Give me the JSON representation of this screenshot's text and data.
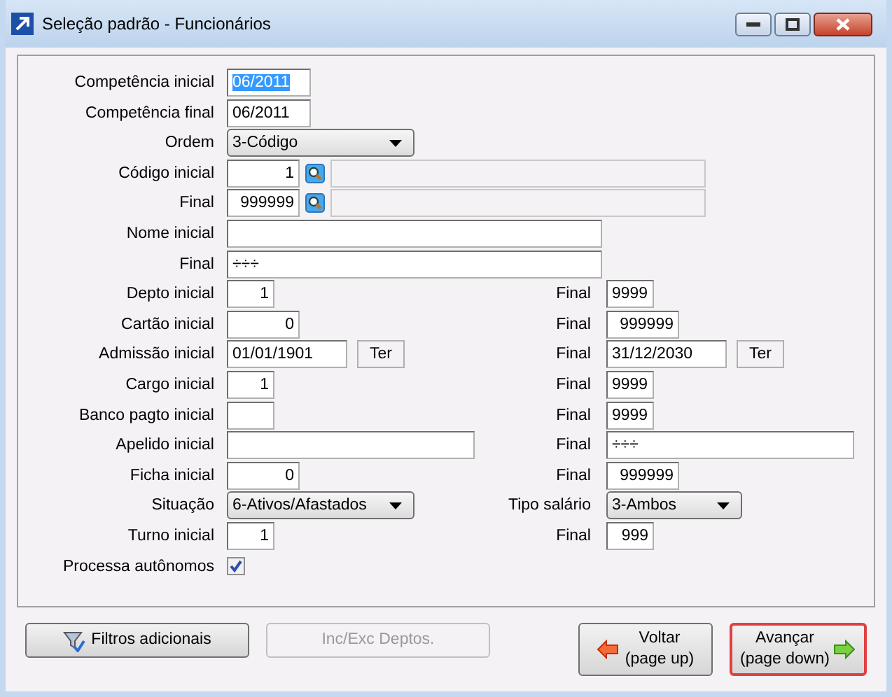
{
  "window": {
    "title": "Seleção padrão - Funcionários"
  },
  "rows": [
    {
      "label": "Competência inicial",
      "field": {
        "kind": "text",
        "value": "06/2011",
        "highlighted": true
      }
    },
    {
      "label": "Competência final",
      "field": {
        "kind": "text",
        "value": "06/2011"
      }
    },
    {
      "label": "Ordem",
      "field": {
        "kind": "select",
        "value": "3-Código"
      }
    },
    {
      "label": "Código inicial",
      "field": {
        "kind": "lookup",
        "value": "1"
      }
    },
    {
      "label": "Final",
      "field": {
        "kind": "lookup",
        "value": "999999"
      }
    },
    {
      "label": "Nome inicial",
      "field": {
        "kind": "text"
      }
    },
    {
      "label": "Final",
      "field": {
        "kind": "text",
        "value": "÷÷÷"
      }
    },
    {
      "label": "Depto inicial",
      "field": {
        "kind": "number",
        "value": "1"
      },
      "right": {
        "label": "Final",
        "field": {
          "kind": "text",
          "value": "9999"
        }
      }
    },
    {
      "label": "Cartão inicial",
      "field": {
        "kind": "number",
        "value": "0"
      },
      "right": {
        "label": "Final",
        "field": {
          "kind": "number",
          "value": "999999"
        }
      }
    },
    {
      "label": "Admissão inicial",
      "field": {
        "kind": "date",
        "value": "01/01/1901",
        "button": "Ter"
      },
      "right": {
        "label": "Final",
        "field": {
          "kind": "date",
          "value": "31/12/2030",
          "button": "Ter"
        }
      }
    },
    {
      "label": "Cargo inicial",
      "field": {
        "kind": "number",
        "value": "1"
      },
      "right": {
        "label": "Final",
        "field": {
          "kind": "text",
          "value": "9999"
        }
      }
    },
    {
      "label": "Banco pagto inicial",
      "field": {
        "kind": "text"
      },
      "right": {
        "label": "Final",
        "field": {
          "kind": "text",
          "value": "9999"
        }
      }
    },
    {
      "label": "Apelido inicial",
      "field": {
        "kind": "text"
      },
      "right": {
        "label": "Final",
        "field": {
          "kind": "text",
          "value": "÷÷÷"
        }
      }
    },
    {
      "label": "Ficha inicial",
      "field": {
        "kind": "number",
        "value": "0"
      },
      "right": {
        "label": "Final",
        "field": {
          "kind": "number",
          "value": "999999"
        }
      }
    },
    {
      "label": "Situação",
      "field": {
        "kind": "select",
        "value": "6-Ativos/Afastados"
      },
      "right": {
        "label": "Tipo salário",
        "field": {
          "kind": "select",
          "value": "3-Ambos"
        }
      }
    },
    {
      "label": "Turno inicial",
      "field": {
        "kind": "number",
        "value": "1"
      },
      "right": {
        "label": "Final",
        "field": {
          "kind": "number",
          "value": "999"
        }
      }
    },
    {
      "label": "Processa autônomos",
      "field": {
        "kind": "checkbox",
        "checked": true
      }
    }
  ],
  "buttons": [
    {
      "kind": "filter",
      "label": "Filtros adicionais",
      "disabled": false,
      "default": false
    },
    {
      "kind": "plain",
      "label": "Inc/Exc Deptos.",
      "disabled": true,
      "default": false
    },
    {
      "kind": "back",
      "label": "Voltar",
      "sub": "(page up)",
      "disabled": false,
      "default": false
    },
    {
      "kind": "next",
      "label": "Avançar",
      "sub": "(page down)",
      "disabled": false,
      "default": true
    }
  ]
}
